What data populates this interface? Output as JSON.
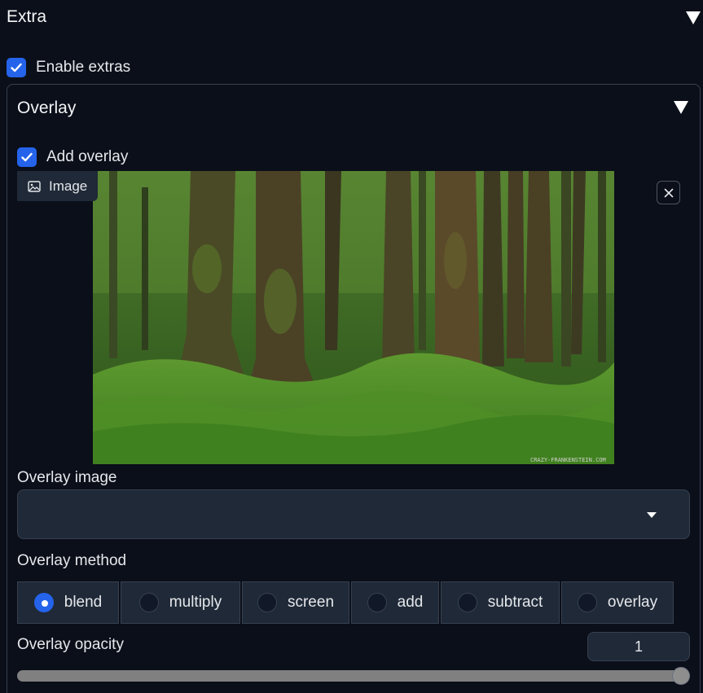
{
  "extra": {
    "title": "Extra",
    "enable_label": "Enable extras",
    "enable_checked": true
  },
  "overlay": {
    "title": "Overlay",
    "add_label": "Add overlay",
    "add_checked": true,
    "image_tag": "Image",
    "image_watermark": "CRAZY-FRANKENSTEIN.COM",
    "image_field_label": "Overlay image",
    "image_field_value": "",
    "method_label": "Overlay method",
    "methods": [
      "blend",
      "multiply",
      "screen",
      "add",
      "subtract",
      "overlay"
    ],
    "selected_method": "blend",
    "opacity_label": "Overlay opacity",
    "opacity_value": "1",
    "opacity_fraction": 1.0
  },
  "colors": {
    "background": "#0b0f19",
    "accent": "#2563eb",
    "surface": "#1f2937",
    "border": "#374151"
  }
}
